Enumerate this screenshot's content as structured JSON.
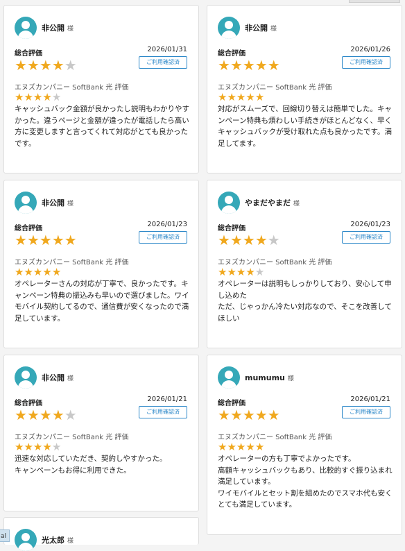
{
  "labels": {
    "overall": "総合評価",
    "confirm_button": "ご利用確認済",
    "honorific": "様",
    "sub_rating_label": "エヌズカンパニー SoftBank 光 評価"
  },
  "colors": {
    "accent": "#2b87c8",
    "star": "#f0a81e",
    "avatar": "#35a8b8"
  },
  "reviews": [
    {
      "name": "非公開",
      "date": "2026/01/31",
      "overall": 4,
      "sub": 4,
      "text": "キャッシュバック金額が良かったし説明もわかりやすかった。違うページと金額が違ったが電話したら高い方に変更しますと言ってくれて対応がとても良かったです。"
    },
    {
      "name": "非公開",
      "date": "2026/01/26",
      "overall": 5,
      "sub": 5,
      "text": "対応がスムーズで、回線切り替えは簡単でした。キャンペーン特典も煩わしい手続きがほとんどなく、早くキャッシュバックが受け取れた点も良かったです。満足してます。"
    },
    {
      "name": "非公開",
      "date": "2026/01/23",
      "overall": 5,
      "sub": 5,
      "text": "オペレーターさんの対応が丁寧で、良かったです。キャンペーン特典の振込みも早いので選びました。ワイモバイル契約してるので、通信費が安くなったので満足しています。"
    },
    {
      "name": "やまだやまだ",
      "date": "2026/01/23",
      "overall": 4,
      "sub": 4,
      "text": "オペレーターは説明もしっかりしており、安心して申し込めた\nただ、じゃっかん冷たい対応なので、そこを改善してほしい"
    },
    {
      "name": "非公開",
      "date": "2026/01/21",
      "overall": 4,
      "sub": 4,
      "text": "迅速な対応していただき、契約しやすかった。\nキャンペーンもお得に利用できた。"
    },
    {
      "name": "mumumu",
      "date": "2026/01/21",
      "overall": 5,
      "sub": 5,
      "text": "オペレーターの方も丁寧でよかったです。\n高額キャッシュバックもあり、比較的すぐ振り込まれ満足しています。\nワイモバイルとセット割を組めたのでスマホ代も安くとても満足しています。"
    },
    {
      "name": "光太郎"
    }
  ],
  "side_tab": "al"
}
